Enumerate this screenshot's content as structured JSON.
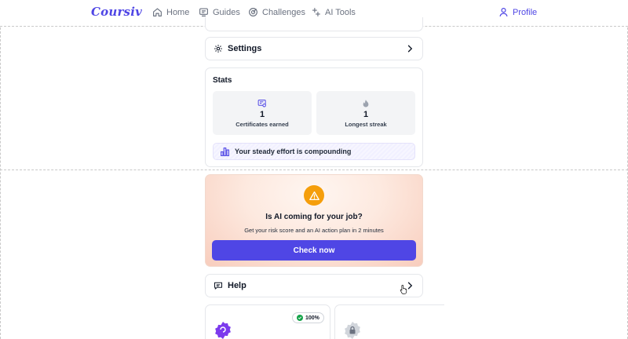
{
  "nav": {
    "logo": "Coursiv",
    "items": [
      {
        "label": "Home",
        "icon": "home-icon"
      },
      {
        "label": "Guides",
        "icon": "guides-icon"
      },
      {
        "label": "Challenges",
        "icon": "challenges-icon"
      },
      {
        "label": "AI Tools",
        "icon": "ai-tools-icon"
      }
    ],
    "profile": {
      "label": "Profile",
      "icon": "user-icon"
    }
  },
  "settings": {
    "label": "Settings",
    "icon": "gear-icon"
  },
  "stats": {
    "title": "Stats",
    "items": [
      {
        "value": "1",
        "label": "Certificates earned",
        "icon": "certificate-icon"
      },
      {
        "value": "1",
        "label": "Longest streak",
        "icon": "flame-icon"
      }
    ],
    "effort_text": "Your steady effort is compounding"
  },
  "promo": {
    "title": "Is AI coming for your job?",
    "subtitle": "Get your risk score and an AI action plan in 2 minutes",
    "button_label": "Check now",
    "icon": "warning-icon"
  },
  "help": {
    "label": "Help",
    "icon": "chat-icon"
  },
  "courses": [
    {
      "badge": "100%",
      "icon": "course-badge-icon"
    },
    {
      "icon": "lock-icon"
    }
  ],
  "colors": {
    "accent": "#4f46e5",
    "warning": "#f59e0b",
    "success": "#16a34a"
  }
}
